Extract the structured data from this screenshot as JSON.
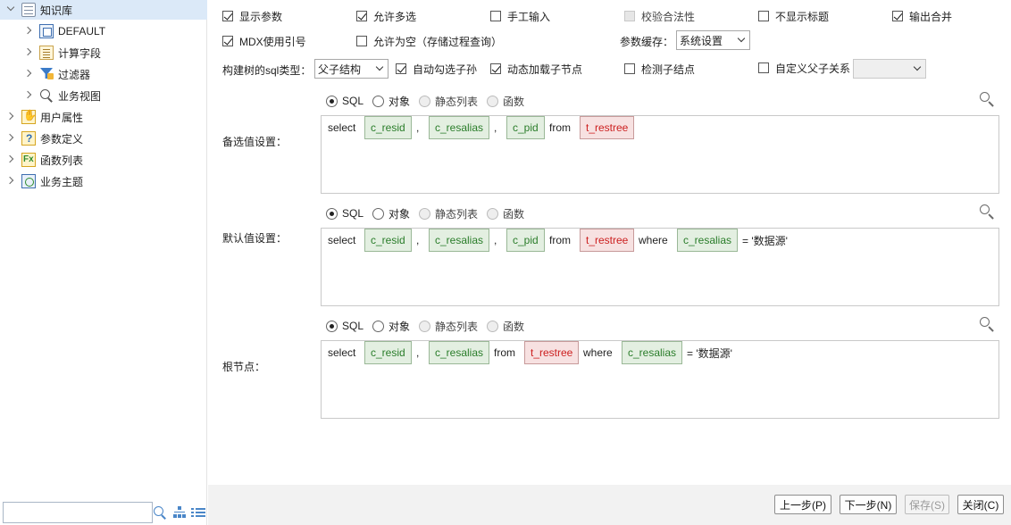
{
  "sidebar": {
    "items": [
      {
        "label": "知识库",
        "icon": "database-icon",
        "expanded": true,
        "selected": true
      },
      {
        "label": "DEFAULT",
        "icon": "datasource-icon"
      },
      {
        "label": "计算字段",
        "icon": "calculated-field-icon"
      },
      {
        "label": "过滤器",
        "icon": "filter-icon"
      },
      {
        "label": "业务视图",
        "icon": "business-view-icon"
      },
      {
        "label": "用户属性",
        "icon": "user-attribute-icon"
      },
      {
        "label": "参数定义",
        "icon": "parameter-definition-icon"
      },
      {
        "label": "函数列表",
        "icon": "function-list-icon"
      },
      {
        "label": "业务主题",
        "icon": "business-subject-icon"
      }
    ],
    "search_value": ""
  },
  "options": {
    "show_param": {
      "label": "显示参数",
      "checked": true
    },
    "allow_multi": {
      "label": "允许多选",
      "checked": true
    },
    "manual_input": {
      "label": "手工输入",
      "checked": false
    },
    "validate": {
      "label": "校验合法性",
      "checked": false,
      "disabled": true
    },
    "hide_title": {
      "label": "不显示标题",
      "checked": false
    },
    "output_merge": {
      "label": "输出合并",
      "checked": true
    },
    "mdx_quote": {
      "label": "MDX使用引号",
      "checked": true
    },
    "allow_empty": {
      "label": "允许为空（存储过程查询）",
      "checked": false
    },
    "cache_label": "参数缓存：",
    "cache_value": "系统设置",
    "tree_sql_label": "构建树的sql类型：",
    "tree_sql_value": "父子结构",
    "auto_check_children": {
      "label": "自动勾选子孙",
      "checked": true
    },
    "dynamic_load": {
      "label": "动态加载子节点",
      "checked": true
    },
    "detect_children": {
      "label": "检测子结点",
      "checked": false
    },
    "custom_relation": {
      "label": "自定义父子关系",
      "checked": false
    },
    "custom_relation_value": ""
  },
  "radio_labels": [
    "SQL",
    "对象",
    "静态列表",
    "函数"
  ],
  "sections": [
    {
      "label": "备选值设置：",
      "tokens": [
        {
          "type": "kw",
          "text": "select"
        },
        {
          "type": "field",
          "text": "c_resid"
        },
        {
          "type": "kw",
          "text": ","
        },
        {
          "type": "field",
          "text": "c_resalias"
        },
        {
          "type": "kw",
          "text": ","
        },
        {
          "type": "field",
          "text": "c_pid"
        },
        {
          "type": "kw",
          "text": "from"
        },
        {
          "type": "table",
          "text": "t_restree"
        }
      ]
    },
    {
      "label": "默认值设置：",
      "tokens": [
        {
          "type": "kw",
          "text": "select"
        },
        {
          "type": "field",
          "text": "c_resid"
        },
        {
          "type": "kw",
          "text": ","
        },
        {
          "type": "field",
          "text": "c_resalias"
        },
        {
          "type": "kw",
          "text": ","
        },
        {
          "type": "field",
          "text": "c_pid"
        },
        {
          "type": "kw",
          "text": "from"
        },
        {
          "type": "table",
          "text": "t_restree"
        },
        {
          "type": "kw",
          "text": "where"
        },
        {
          "type": "field",
          "text": "c_resalias"
        },
        {
          "type": "kw",
          "text": "= '数据源'"
        }
      ]
    },
    {
      "label": "根节点：",
      "tokens": [
        {
          "type": "kw",
          "text": "select"
        },
        {
          "type": "field",
          "text": "c_resid"
        },
        {
          "type": "kw",
          "text": ","
        },
        {
          "type": "field",
          "text": "c_resalias"
        },
        {
          "type": "kw",
          "text": "from"
        },
        {
          "type": "table",
          "text": "t_restree"
        },
        {
          "type": "kw",
          "text": "where"
        },
        {
          "type": "field",
          "text": "c_resalias"
        },
        {
          "type": "kw",
          "text": "= '数据源'"
        }
      ]
    }
  ],
  "buttons": {
    "prev": "上一步(P)",
    "next": "下一步(N)",
    "save": "保存(S)",
    "close": "关闭(C)"
  }
}
